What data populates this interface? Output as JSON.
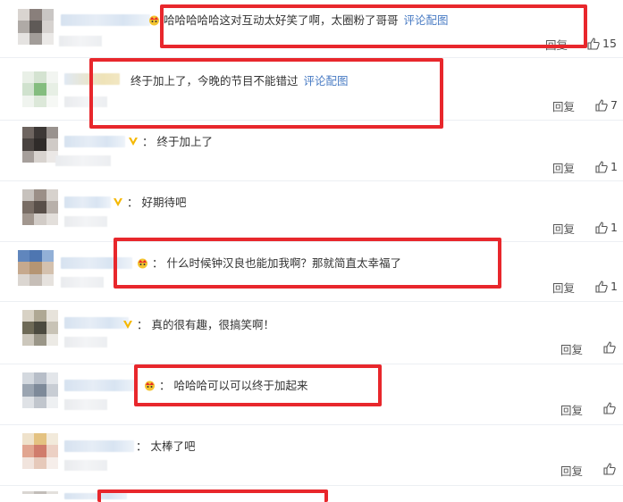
{
  "comments": [
    {
      "text": "哈哈哈哈哈这对互动太好笑了啊，太圈粉了哥哥",
      "link": "评论配图",
      "reply": "回复",
      "likes": "15"
    },
    {
      "text": "终于加上了，今晚的节目不能错过",
      "link": "评论配图",
      "reply": "回复",
      "likes": "7"
    },
    {
      "text": "：  终于加上了",
      "link": "",
      "reply": "回复",
      "likes": "1"
    },
    {
      "text": "：  好期待吧",
      "link": "",
      "reply": "回复",
      "likes": "1"
    },
    {
      "text": "：  什么时候钟汉良也能加我啊？那就简直太幸福了",
      "link": "",
      "reply": "回复",
      "likes": "1"
    },
    {
      "text": "：  真的很有趣，很搞笑啊！",
      "link": "",
      "reply": "回复",
      "likes": ""
    },
    {
      "text": "：  哈哈哈可以可以终于加起来",
      "link": "",
      "reply": "回复",
      "likes": ""
    },
    {
      "text": "：  太棒了吧",
      "link": "",
      "reply": "回复",
      "likes": ""
    }
  ],
  "colors": {
    "highlight": "#e8272c",
    "link": "#4a7cc4",
    "vip_badge": "#f5b800"
  },
  "icons": {
    "like": "thumbs-up-icon",
    "crown": "crown-icon",
    "vip": "v-badge-icon"
  }
}
